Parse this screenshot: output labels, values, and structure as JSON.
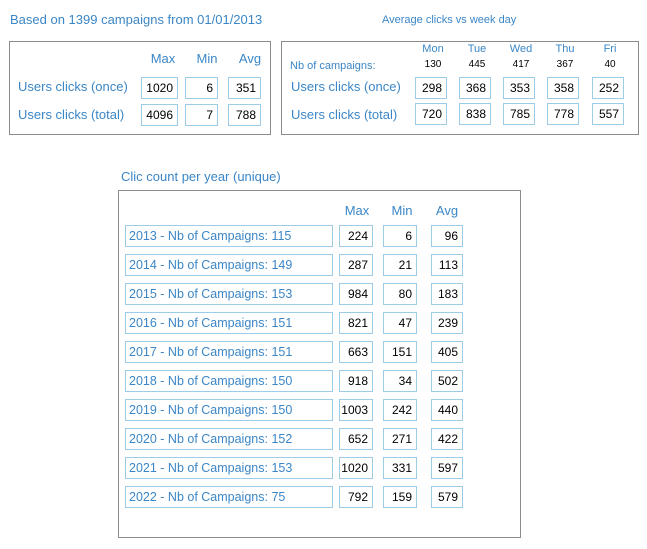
{
  "header": {
    "summary_title": "Based on 1399 campaigns from 01/01/2013",
    "week_title": "Average clicks vs week day",
    "year_title": "Clic count per year (unique)"
  },
  "summary": {
    "columns": [
      "Max",
      "Min",
      "Avg"
    ],
    "rows": [
      {
        "label": "Users clicks (once)",
        "values": [
          "1020",
          "6",
          "351"
        ]
      },
      {
        "label": "Users clicks (total)",
        "values": [
          "4096",
          "7",
          "788"
        ]
      }
    ]
  },
  "week": {
    "campaigns_label": "Nb of campaigns:",
    "days": [
      "Mon",
      "Tue",
      "Wed",
      "Thu",
      "Fri"
    ],
    "campaign_counts": [
      "130",
      "445",
      "417",
      "367",
      "40"
    ],
    "rows": [
      {
        "label": "Users clicks (once)",
        "values": [
          "298",
          "368",
          "353",
          "358",
          "252"
        ]
      },
      {
        "label": "Users clicks (total)",
        "values": [
          "720",
          "838",
          "785",
          "778",
          "557"
        ]
      }
    ]
  },
  "years": {
    "columns": [
      "Max",
      "Min",
      "Avg"
    ],
    "rows": [
      {
        "label": "2013 - Nb of Campaigns: 115",
        "values": [
          "224",
          "6",
          "96"
        ]
      },
      {
        "label": "2014 - Nb of Campaigns: 149",
        "values": [
          "287",
          "21",
          "113"
        ]
      },
      {
        "label": "2015 - Nb of Campaigns: 153",
        "values": [
          "984",
          "80",
          "183"
        ]
      },
      {
        "label": "2016 - Nb of Campaigns: 151",
        "values": [
          "821",
          "47",
          "239"
        ]
      },
      {
        "label": "2017 - Nb of Campaigns: 151",
        "values": [
          "663",
          "151",
          "405"
        ]
      },
      {
        "label": "2018 - Nb of Campaigns: 150",
        "values": [
          "918",
          "34",
          "502"
        ]
      },
      {
        "label": "2019 - Nb of Campaigns: 150",
        "values": [
          "1003",
          "242",
          "440"
        ]
      },
      {
        "label": "2020 - Nb of Campaigns: 152",
        "values": [
          "652",
          "271",
          "422"
        ]
      },
      {
        "label": "2021 - Nb of Campaigns: 153",
        "values": [
          "1020",
          "331",
          "597"
        ]
      },
      {
        "label": "2022 - Nb of Campaigns: 75",
        "values": [
          "792",
          "159",
          "579"
        ]
      }
    ]
  },
  "colors": {
    "label_text": "#3b86c6",
    "cell_border": "#9ccce8",
    "panel_border": "#8c8c8c"
  }
}
